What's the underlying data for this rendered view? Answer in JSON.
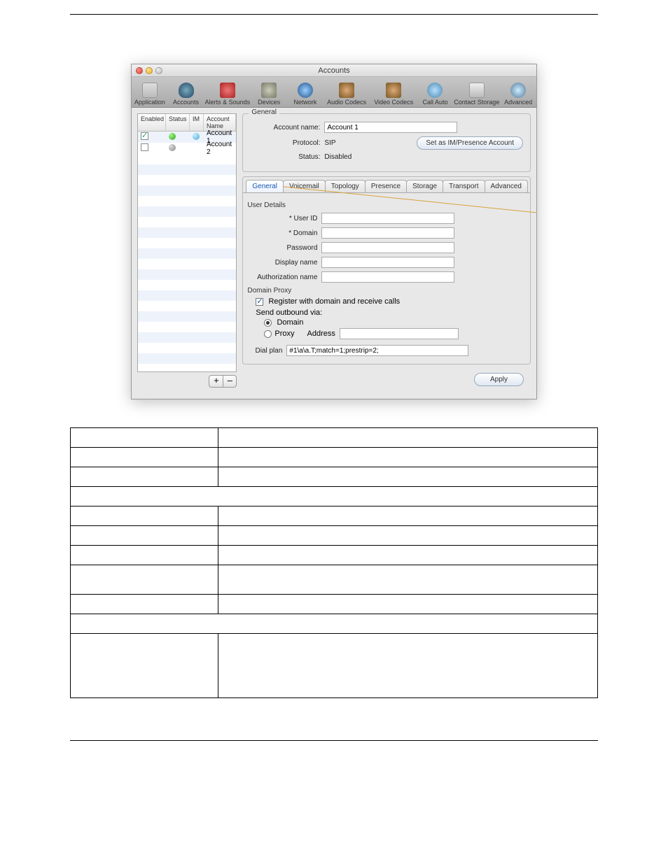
{
  "window": {
    "title": "Accounts",
    "toolbar": [
      {
        "label": "Application",
        "name": "tb-application"
      },
      {
        "label": "Accounts",
        "name": "tb-accounts"
      },
      {
        "label": "Alerts & Sounds",
        "name": "tb-alerts"
      },
      {
        "label": "Devices",
        "name": "tb-devices"
      },
      {
        "label": "Network",
        "name": "tb-network"
      },
      {
        "label": "Audio Codecs",
        "name": "tb-audio"
      },
      {
        "label": "Video Codecs",
        "name": "tb-video"
      },
      {
        "label": "Call Auto",
        "name": "tb-callauto"
      },
      {
        "label": "Contact Storage",
        "name": "tb-storage"
      },
      {
        "label": "Advanced",
        "name": "tb-advanced"
      }
    ],
    "list": {
      "headers": {
        "enabled": "Enabled",
        "status": "Status",
        "im": "IM",
        "name": "Account Name"
      },
      "rows": [
        {
          "enabled": true,
          "status": "green",
          "im": "presence",
          "name": "Account 1"
        },
        {
          "enabled": false,
          "status": "gray",
          "im": "",
          "name": "Account 2"
        }
      ],
      "add": "+",
      "remove": "–"
    },
    "general": {
      "group": "General",
      "account_name_label": "Account name:",
      "account_name_value": "Account 1",
      "protocol_label": "Protocol:",
      "protocol_value": "SIP",
      "status_label": "Status:",
      "status_value": "Disabled",
      "set_presence": "Set as IM/Presence Account"
    },
    "tabs": [
      "General",
      "Voicemail",
      "Topology",
      "Presence",
      "Storage",
      "Transport",
      "Advanced"
    ],
    "user_details": {
      "header": "User Details",
      "user_id_label": "* User ID",
      "domain_label": "* Domain",
      "password_label": "Password",
      "display_label": "Display name",
      "auth_label": "Authorization name"
    },
    "domain_proxy": {
      "header": "Domain Proxy",
      "register_label": "Register with domain and receive calls",
      "send_via_label": "Send outbound via:",
      "domain_option": "Domain",
      "proxy_option": "Proxy",
      "address_label": "Address"
    },
    "dial_plan": {
      "label": "Dial plan",
      "value": "#1\\a\\a.T;match=1;prestrip=2;"
    },
    "apply": "Apply"
  }
}
